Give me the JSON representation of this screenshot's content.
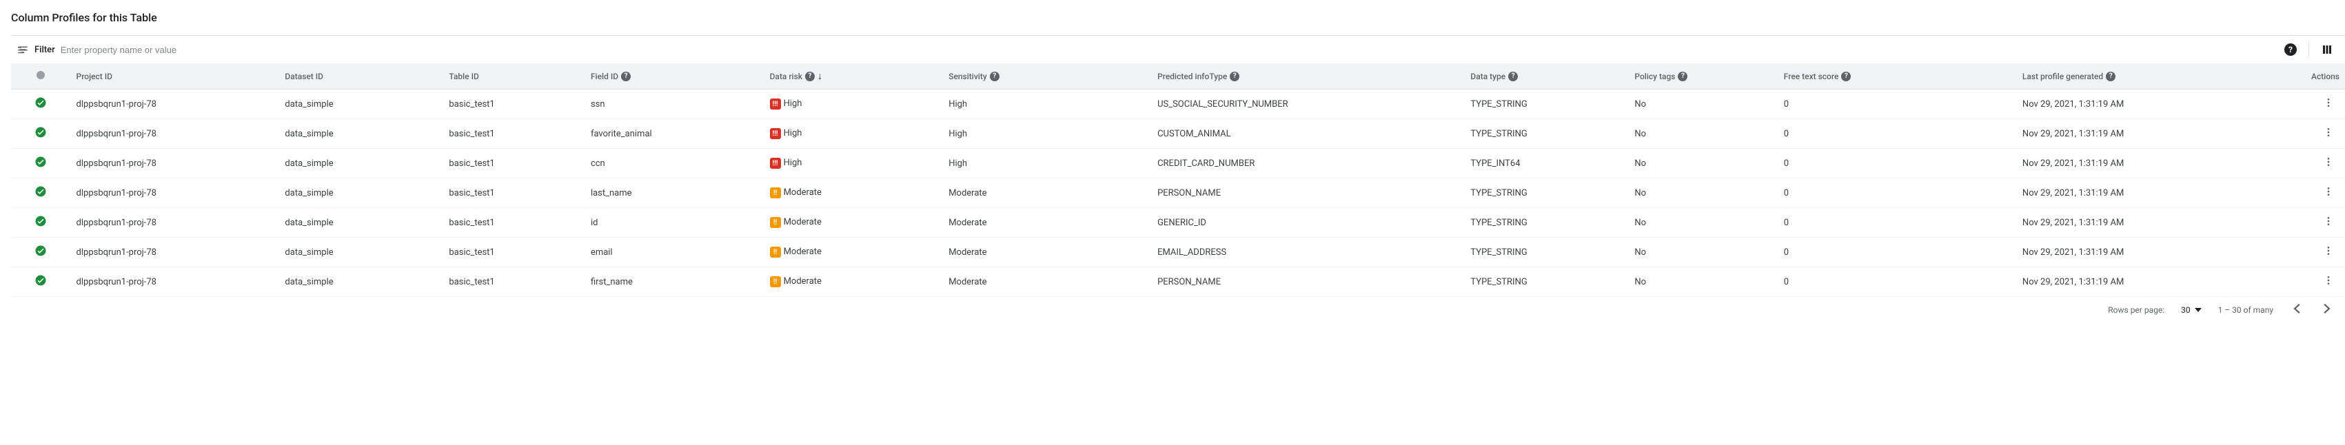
{
  "title": "Column Profiles for this Table",
  "filter": {
    "label": "Filter",
    "placeholder": "Enter property name or value"
  },
  "columns": {
    "project_id": "Project ID",
    "dataset_id": "Dataset ID",
    "table_id": "Table ID",
    "field_id": "Field ID",
    "data_risk": "Data risk",
    "sensitivity": "Sensitivity",
    "predicted_infotype": "Predicted infoType",
    "data_type": "Data type",
    "policy_tags": "Policy tags",
    "free_text_score": "Free text score",
    "last_profile": "Last profile generated",
    "actions": "Actions"
  },
  "rows": [
    {
      "project": "dlppsbqrun1-proj-78",
      "dataset": "data_simple",
      "table": "basic_test1",
      "field": "ssn",
      "risk": "High",
      "risk_level": "high",
      "sensitivity": "High",
      "infotype": "US_SOCIAL_SECURITY_NUMBER",
      "datatype": "TYPE_STRING",
      "policy": "No",
      "freetext": "0",
      "lastprofile": "Nov 29, 2021, 1:31:19 AM"
    },
    {
      "project": "dlppsbqrun1-proj-78",
      "dataset": "data_simple",
      "table": "basic_test1",
      "field": "favorite_animal",
      "risk": "High",
      "risk_level": "high",
      "sensitivity": "High",
      "infotype": "CUSTOM_ANIMAL",
      "datatype": "TYPE_STRING",
      "policy": "No",
      "freetext": "0",
      "lastprofile": "Nov 29, 2021, 1:31:19 AM"
    },
    {
      "project": "dlppsbqrun1-proj-78",
      "dataset": "data_simple",
      "table": "basic_test1",
      "field": "ccn",
      "risk": "High",
      "risk_level": "high",
      "sensitivity": "High",
      "infotype": "CREDIT_CARD_NUMBER",
      "datatype": "TYPE_INT64",
      "policy": "No",
      "freetext": "0",
      "lastprofile": "Nov 29, 2021, 1:31:19 AM"
    },
    {
      "project": "dlppsbqrun1-proj-78",
      "dataset": "data_simple",
      "table": "basic_test1",
      "field": "last_name",
      "risk": "Moderate",
      "risk_level": "moderate",
      "sensitivity": "Moderate",
      "infotype": "PERSON_NAME",
      "datatype": "TYPE_STRING",
      "policy": "No",
      "freetext": "0",
      "lastprofile": "Nov 29, 2021, 1:31:19 AM"
    },
    {
      "project": "dlppsbqrun1-proj-78",
      "dataset": "data_simple",
      "table": "basic_test1",
      "field": "id",
      "risk": "Moderate",
      "risk_level": "moderate",
      "sensitivity": "Moderate",
      "infotype": "GENERIC_ID",
      "datatype": "TYPE_STRING",
      "policy": "No",
      "freetext": "0",
      "lastprofile": "Nov 29, 2021, 1:31:19 AM"
    },
    {
      "project": "dlppsbqrun1-proj-78",
      "dataset": "data_simple",
      "table": "basic_test1",
      "field": "email",
      "risk": "Moderate",
      "risk_level": "moderate",
      "sensitivity": "Moderate",
      "infotype": "EMAIL_ADDRESS",
      "datatype": "TYPE_STRING",
      "policy": "No",
      "freetext": "0",
      "lastprofile": "Nov 29, 2021, 1:31:19 AM"
    },
    {
      "project": "dlppsbqrun1-proj-78",
      "dataset": "data_simple",
      "table": "basic_test1",
      "field": "first_name",
      "risk": "Moderate",
      "risk_level": "moderate",
      "sensitivity": "Moderate",
      "infotype": "PERSON_NAME",
      "datatype": "TYPE_STRING",
      "policy": "No",
      "freetext": "0",
      "lastprofile": "Nov 29, 2021, 1:31:19 AM"
    }
  ],
  "pagination": {
    "rows_per_page_label": "Rows per page:",
    "rows_per_page_value": "30",
    "range_text": "1 – 30 of many"
  },
  "icons": {
    "high_badge": "!!!",
    "moderate_badge": "!!"
  }
}
